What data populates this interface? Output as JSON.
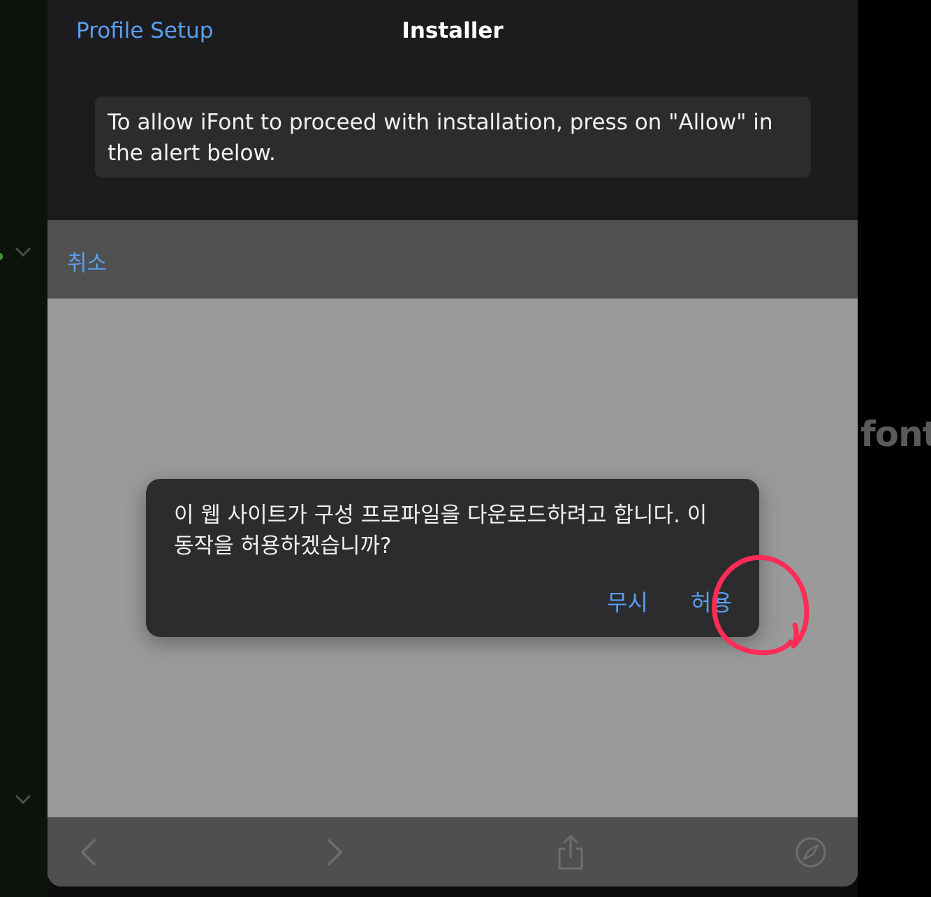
{
  "navigation": {
    "back_label": "Profile Setup",
    "title": "Installer"
  },
  "info": {
    "message": "To allow iFont to proceed with installation, press on \"Allow\" in the alert below."
  },
  "web_toolbar": {
    "cancel_label": "취소"
  },
  "alert": {
    "message": "이 웹 사이트가 구성 프로파일을 다운로드하려고 합니다. 이 동작을 허용하겠습니까?",
    "ignore_label": "무시",
    "allow_label": "허용"
  },
  "bottom_toolbar": {
    "icons": [
      "chevron-left-icon",
      "chevron-right-icon",
      "share-icon",
      "compass-icon"
    ]
  },
  "background": {
    "app_text": "font"
  },
  "colors": {
    "accent": "#5a9ef0",
    "annotation": "#ff2d55",
    "nav_background": "#1c1c1e",
    "alert_background": "#2c2c2e"
  }
}
